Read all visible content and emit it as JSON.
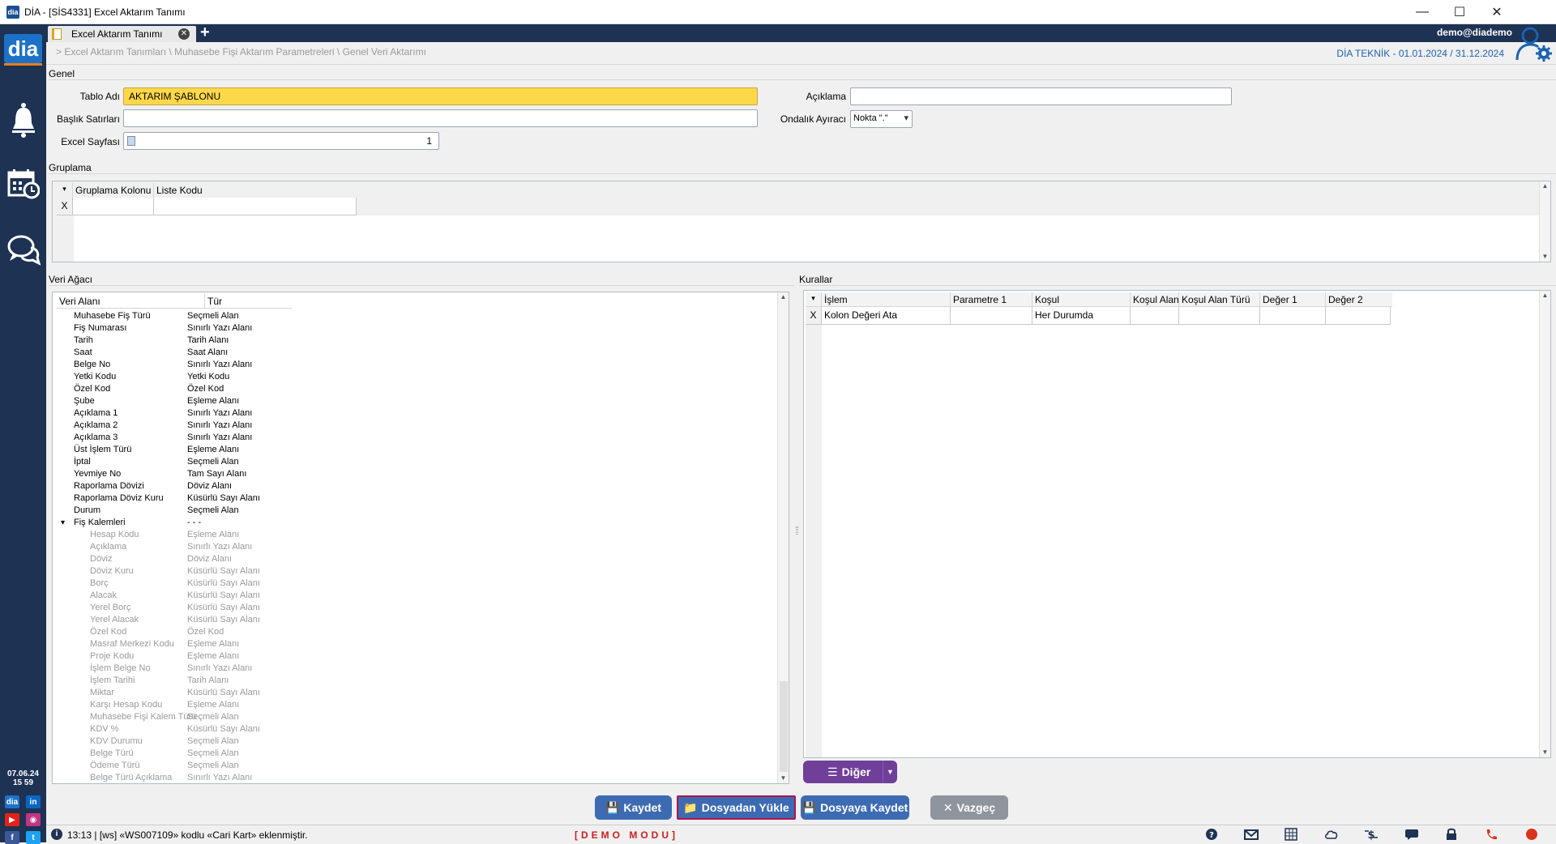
{
  "window": {
    "title": "DİA - [SİS4331] Excel Aktarım Tanımı"
  },
  "tab": {
    "label": "Excel Aktarım Tanımı"
  },
  "header": {
    "user": "demo@diademo",
    "breadcrumb": "> Excel Aktarım Tanımları \\ Muhasebe Fişi Aktarım Parametreleri \\ Genel Veri Aktarımı",
    "company": "DİA TEKNİK -  01.01.2024 / 31.12.2024"
  },
  "sidebar": {
    "brand": "dia",
    "date": "07.06.24",
    "time": "15 59"
  },
  "genel": {
    "section": "Genel",
    "tablo_adi_label": "Tablo Adı",
    "tablo_adi_value": "AKTARIM ŞABLONU",
    "aciklama_label": "Açıklama",
    "aciklama_value": "",
    "baslik_label": "Başlık Satırları",
    "baslik_value": "",
    "ondalik_label": "Ondalık Ayıracı",
    "ondalik_value": "Nokta \".\"",
    "excel_sayfasi_label": "Excel Sayfası",
    "excel_sayfasi_value": "1"
  },
  "gruplama": {
    "section": "Gruplama",
    "columns": [
      "Gruplama Kolonu",
      "Liste Kodu"
    ],
    "row_marker": "X"
  },
  "veri_agaci": {
    "section": "Veri Ağacı",
    "columns": [
      "Veri Alanı",
      "Tür"
    ],
    "rows": [
      {
        "field": "Muhasebe Fiş Türü",
        "type": "Seçmeli Alan",
        "level": 1,
        "disabled": false
      },
      {
        "field": "Fiş Numarası",
        "type": "Sınırlı Yazı Alanı",
        "level": 1,
        "disabled": false
      },
      {
        "field": "Tarih",
        "type": "Tarih Alanı",
        "level": 1,
        "disabled": false
      },
      {
        "field": "Saat",
        "type": "Saat Alanı",
        "level": 1,
        "disabled": false
      },
      {
        "field": "Belge No",
        "type": "Sınırlı Yazı Alanı",
        "level": 1,
        "disabled": false
      },
      {
        "field": "Yetki Kodu",
        "type": "Yetki Kodu",
        "level": 1,
        "disabled": false
      },
      {
        "field": "Özel Kod",
        "type": "Özel Kod",
        "level": 1,
        "disabled": false
      },
      {
        "field": "Şube",
        "type": "Eşleme Alanı",
        "level": 1,
        "disabled": false
      },
      {
        "field": "Açıklama 1",
        "type": "Sınırlı Yazı Alanı",
        "level": 1,
        "disabled": false
      },
      {
        "field": "Açıklama 2",
        "type": "Sınırlı Yazı Alanı",
        "level": 1,
        "disabled": false
      },
      {
        "field": "Açıklama 3",
        "type": "Sınırlı Yazı Alanı",
        "level": 1,
        "disabled": false
      },
      {
        "field": "Üst İşlem Türü",
        "type": "Eşleme Alanı",
        "level": 1,
        "disabled": false
      },
      {
        "field": "İptal",
        "type": "Seçmeli Alan",
        "level": 1,
        "disabled": false
      },
      {
        "field": "Yevmiye No",
        "type": "Tam Sayı Alanı",
        "level": 1,
        "disabled": false
      },
      {
        "field": "Raporlama Dövizi",
        "type": "Döviz Alanı",
        "level": 1,
        "disabled": false
      },
      {
        "field": "Raporlama Döviz Kuru",
        "type": "Küsürlü Sayı Alanı",
        "level": 1,
        "disabled": false
      },
      {
        "field": "Durum",
        "type": "Seçmeli Alan",
        "level": 1,
        "disabled": false
      },
      {
        "field": "Fiş Kalemleri",
        "type": "- - -",
        "level": 1,
        "disabled": false,
        "expander": "▾"
      },
      {
        "field": "Hesap Kodu",
        "type": "Eşleme Alanı",
        "level": 2,
        "disabled": true
      },
      {
        "field": "Açıklama",
        "type": "Sınırlı Yazı Alanı",
        "level": 2,
        "disabled": true
      },
      {
        "field": "Döviz",
        "type": "Döviz Alanı",
        "level": 2,
        "disabled": true
      },
      {
        "field": "Döviz Kuru",
        "type": "Küsürlü Sayı Alanı",
        "level": 2,
        "disabled": true
      },
      {
        "field": "Borç",
        "type": "Küsürlü Sayı Alanı",
        "level": 2,
        "disabled": true
      },
      {
        "field": "Alacak",
        "type": "Küsürlü Sayı Alanı",
        "level": 2,
        "disabled": true
      },
      {
        "field": "Yerel Borç",
        "type": "Küsürlü Sayı Alanı",
        "level": 2,
        "disabled": true
      },
      {
        "field": "Yerel Alacak",
        "type": "Küsürlü Sayı Alanı",
        "level": 2,
        "disabled": true
      },
      {
        "field": "Özel Kod",
        "type": "Özel Kod",
        "level": 2,
        "disabled": true
      },
      {
        "field": "Masraf Merkezi Kodu",
        "type": "Eşleme Alanı",
        "level": 2,
        "disabled": true
      },
      {
        "field": "Proje Kodu",
        "type": "Eşleme Alanı",
        "level": 2,
        "disabled": true
      },
      {
        "field": "İşlem Belge No",
        "type": "Sınırlı Yazı Alanı",
        "level": 2,
        "disabled": true
      },
      {
        "field": "İşlem Tarihi",
        "type": "Tarih Alanı",
        "level": 2,
        "disabled": true
      },
      {
        "field": "Miktar",
        "type": "Küsürlü Sayı Alanı",
        "level": 2,
        "disabled": true
      },
      {
        "field": "Karşı Hesap Kodu",
        "type": "Eşleme Alanı",
        "level": 2,
        "disabled": true
      },
      {
        "field": "Muhasebe Fişi Kalem Türü",
        "type": "Seçmeli Alan",
        "level": 2,
        "disabled": true
      },
      {
        "field": "KDV %",
        "type": "Küsürlü Sayı Alanı",
        "level": 2,
        "disabled": true
      },
      {
        "field": "KDV Durumu",
        "type": "Seçmeli Alan",
        "level": 2,
        "disabled": true
      },
      {
        "field": "Belge Türü",
        "type": "Seçmeli Alan",
        "level": 2,
        "disabled": true
      },
      {
        "field": "Ödeme Türü",
        "type": "Seçmeli Alan",
        "level": 2,
        "disabled": true
      },
      {
        "field": "Belge Türü Açıklama",
        "type": "Sınırlı Yazı Alanı",
        "level": 2,
        "disabled": true
      }
    ]
  },
  "kurallar": {
    "section": "Kurallar",
    "columns": [
      "İşlem",
      "Parametre 1",
      "Koşul",
      "Koşul Alan",
      "Koşul Alan Türü",
      "Değer 1",
      "Değer 2"
    ],
    "rows": [
      {
        "marker": "X",
        "islem": "Kolon Değeri Ata",
        "parametre1": "",
        "kosul": "Her Durumda",
        "kosul_alan": "",
        "kosul_alan_turu": "",
        "deger1": "",
        "deger2": ""
      }
    ],
    "diger_button": "Diğer"
  },
  "buttons": {
    "kaydet": "Kaydet",
    "dosyadan_yukle": "Dosyadan Yükle",
    "dosyaya_kaydet": "Dosyaya Kaydet",
    "vazgec": "Vazgeç"
  },
  "colors": {
    "sidebar": "#1e3253",
    "primary_button": "#3d6bb3",
    "diger_button": "#6f3f9a",
    "vazgec_button": "#8f959d",
    "highlight_border": "#b3124f",
    "field_highlight": "#ffd84a"
  },
  "status": {
    "message": "13:13 | [ws] «WS007109» kodlu «Cari Kart» eklenmiştir.",
    "mode": "[DEMO MODU]"
  }
}
